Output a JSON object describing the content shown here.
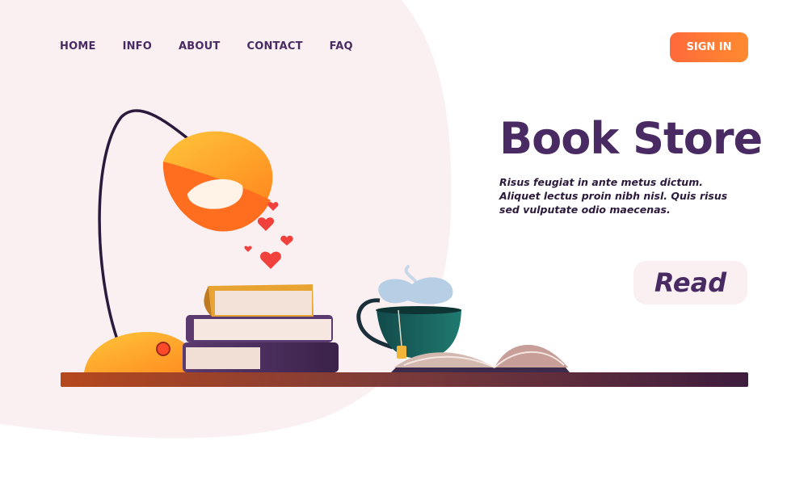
{
  "nav": {
    "items": [
      {
        "label": "HOME"
      },
      {
        "label": "INFO"
      },
      {
        "label": "ABOUT"
      },
      {
        "label": "CONTACT"
      },
      {
        "label": "FAQ"
      }
    ]
  },
  "header": {
    "sign_in_label": "SIGN IN"
  },
  "hero": {
    "title": "Book Store",
    "description": "Risus feugiat in ante metus dictum. Aliquet lectus proin nibh nisl. Quis risus sed vulputate odio  maecenas.",
    "read_label": "Read"
  },
  "colors": {
    "brand": "#4a2a63",
    "accent": "#ff6a3a",
    "blob": "#faf0f2"
  },
  "icons": [
    "desk-lamp-icon",
    "heart-icon",
    "book-stack-icon",
    "tea-cup-icon",
    "open-book-icon"
  ]
}
